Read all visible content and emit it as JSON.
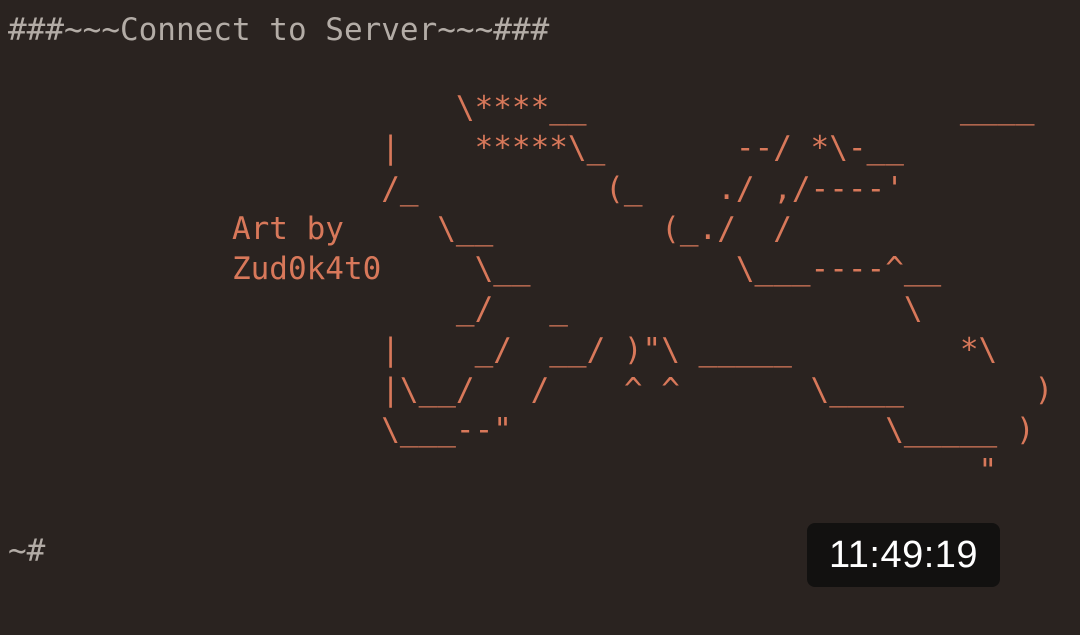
{
  "terminal": {
    "header": "###~~~Connect to Server~~~###",
    "art": "                        \\****__                    ____\n                    |    *****\\_       --/ *\\-__\n                    /_          (_    ./ ,/----'\n            Art by     \\__         (_./  /\n            Zud0k4t0     \\__           \\___----^__\n                        _/   _                  \\\n                    |    _/  __/ )\"\\ _____         *\\\n                    |\\__/   /    ^ ^       \\____       )\n                    \\___--\"                    \\_____ )\n                                                    \"",
    "prompt": "~#"
  },
  "clock": {
    "time": "11:49:19"
  },
  "colors": {
    "background": "#2a2320",
    "text": "#b3aca6",
    "art": "#d8785a",
    "clock_background": "#121110",
    "clock_text": "#ffffff"
  }
}
